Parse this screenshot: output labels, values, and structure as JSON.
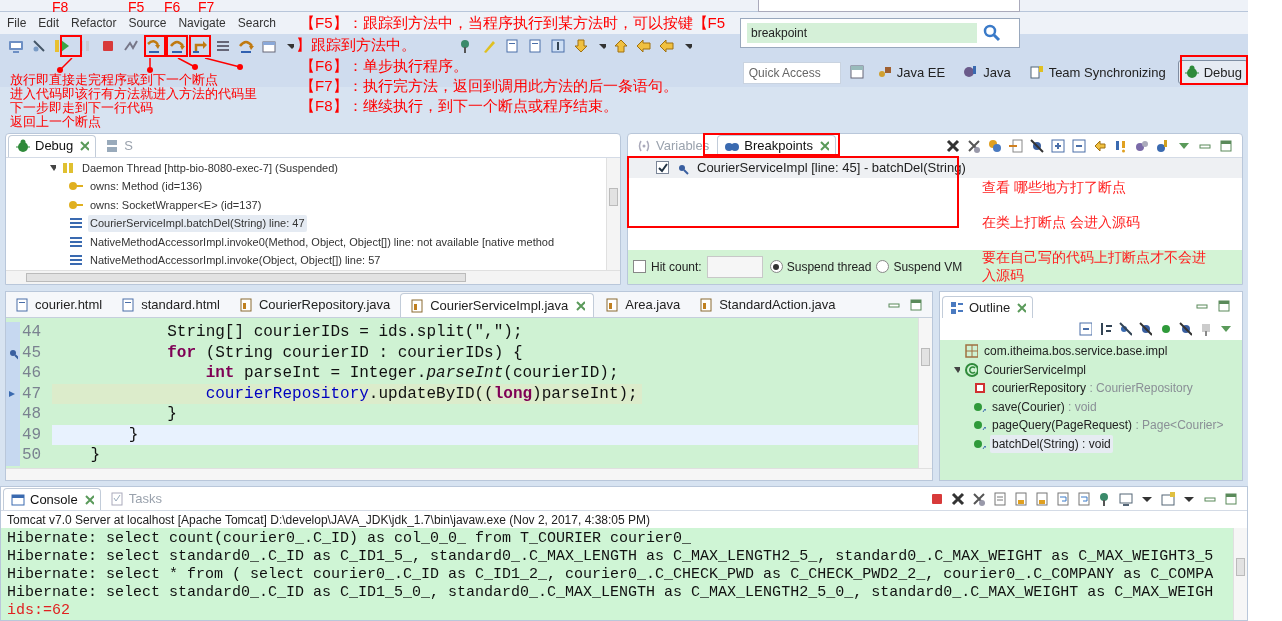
{
  "search_popup": {
    "value": "breakpoint"
  },
  "menu": [
    "File",
    "Edit",
    "Refactor",
    "Source",
    "Navigate",
    "Search"
  ],
  "quick_access": {
    "placeholder": "Quick Access"
  },
  "perspectives": [
    {
      "label": "Java EE",
      "selected": false
    },
    {
      "label": "Java",
      "selected": false
    },
    {
      "label": "Team Synchronizing",
      "selected": false
    },
    {
      "label": "Debug",
      "selected": true
    }
  ],
  "debug_view": {
    "tabs": [
      {
        "label": "Debug",
        "selected": true
      },
      {
        "label": "S",
        "selected": false
      }
    ],
    "tree": [
      {
        "text": "Daemon Thread [http-bio-8080-exec-7] (Suspended)",
        "kind": "thread",
        "expanded": true,
        "selected": false,
        "children": [
          {
            "text": "owns: Method  (id=136)",
            "kind": "monitor",
            "selected": false
          },
          {
            "text": "owns: SocketWrapper<E>  (id=137)",
            "kind": "monitor",
            "selected": false
          },
          {
            "text": "CourierServiceImpl.batchDel(String) line: 47",
            "kind": "frame",
            "selected": true
          },
          {
            "text": "NativeMethodAccessorImpl.invoke0(Method, Object, Object[]) line: not available [native method",
            "kind": "frame",
            "selected": false
          },
          {
            "text": "NativeMethodAccessorImpl.invoke(Object, Object[]) line: 57",
            "kind": "frame",
            "selected": false
          }
        ]
      }
    ]
  },
  "breakpoints_view": {
    "tabs": [
      {
        "label": "Variables",
        "selected": false
      },
      {
        "label": "Breakpoints",
        "selected": true
      }
    ],
    "breakpoints": [
      {
        "text": "CourierServiceImpl [line: 45] - batchDel(String)",
        "checked": true
      }
    ],
    "hit_count": {
      "label": "Hit count:",
      "checked": false
    },
    "suspend": [
      {
        "label": "Suspend thread",
        "selected": true
      },
      {
        "label": "Suspend VM",
        "selected": false
      }
    ]
  },
  "editor": {
    "tabs": [
      {
        "label": "courier.html",
        "kind": "html",
        "selected": false
      },
      {
        "label": "standard.html",
        "kind": "html",
        "selected": false
      },
      {
        "label": "CourierRepository.java",
        "kind": "java",
        "selected": false
      },
      {
        "label": "CourierServiceImpl.java",
        "kind": "java",
        "selected": true
      },
      {
        "label": "Area.java",
        "kind": "java",
        "selected": false
      },
      {
        "label": "StandardAction.java",
        "kind": "java",
        "selected": false
      }
    ],
    "lines": [
      {
        "number": "44",
        "breakpoint": false,
        "current": false,
        "cursor": false,
        "tokens": [
          {
            "text": "            String[] courierIDs = ids.split(\",\");",
            "kind": "plain"
          }
        ]
      },
      {
        "number": "45",
        "breakpoint": true,
        "current": false,
        "cursor": false,
        "tokens": [
          {
            "text": "            for",
            "kind": "keyword"
          },
          {
            "text": " (String courierID : courierIDs) {",
            "kind": "plain"
          }
        ]
      },
      {
        "number": "46",
        "breakpoint": false,
        "current": false,
        "cursor": false,
        "tokens": [
          {
            "text": "                int",
            "kind": "keyword"
          },
          {
            "text": " parseInt = Integer.",
            "kind": "plain"
          },
          {
            "text": "parseInt",
            "kind": "static"
          },
          {
            "text": "(courierID);",
            "kind": "plain"
          }
        ]
      },
      {
        "number": "47",
        "breakpoint": false,
        "current": true,
        "cursor": false,
        "tokens": [
          {
            "text": "                courierRepository",
            "kind": "field"
          },
          {
            "text": ".updateByID((",
            "kind": "plain"
          },
          {
            "text": "long",
            "kind": "keyword"
          },
          {
            "text": ")parseInt);",
            "kind": "plain"
          }
        ]
      },
      {
        "number": "48",
        "breakpoint": false,
        "current": false,
        "cursor": false,
        "tokens": [
          {
            "text": "            }",
            "kind": "plain"
          }
        ]
      },
      {
        "number": "49",
        "breakpoint": false,
        "current": false,
        "cursor": true,
        "tokens": [
          {
            "text": "        }",
            "kind": "plain"
          }
        ]
      },
      {
        "number": "50",
        "breakpoint": false,
        "current": false,
        "cursor": false,
        "tokens": [
          {
            "text": "    }",
            "kind": "plain"
          }
        ]
      }
    ]
  },
  "outline": {
    "title": "Outline",
    "tree": [
      {
        "name": "com.itheima.bos.service.base.impl",
        "kind": "package",
        "selected": false
      },
      {
        "name": "CourierServiceImpl",
        "kind": "class",
        "expanded": true,
        "selected": false,
        "children": [
          {
            "name": "courierRepository",
            "type": " : CourierRepository",
            "kind": "field",
            "selected": false
          },
          {
            "name": "save(Courier)",
            "type": " : void",
            "kind": "method",
            "selected": false
          },
          {
            "name": "pageQuery(PageRequest)",
            "type": " : Page<Courier>",
            "kind": "method",
            "selected": false
          },
          {
            "name": "batchDel(String)",
            "type": " : void",
            "kind": "method",
            "selected": true
          }
        ]
      }
    ]
  },
  "console": {
    "tabs": [
      {
        "label": "Console",
        "selected": true
      },
      {
        "label": "Tasks",
        "selected": false
      }
    ],
    "launch": "Tomcat v7.0 Server at localhost [Apache Tomcat] D:\\develop\\JAVA_JDK\\jdk_1.7\\bin\\javaw.exe (Nov 2, 2017, 4:38:05 PM)",
    "lines": [
      {
        "text": "Hibernate: select count(courier0_.C_ID) as col_0_0_ from T_COURIER courier0_",
        "kind": "out"
      },
      {
        "text": "Hibernate: select standard0_.C_ID as C_ID1_5_, standard0_.C_MAX_LENGTH as C_MAX_LENGTH2_5_, standard0_.C_MAX_WEIGHT as C_MAX_WEIGHT3_5",
        "kind": "out"
      },
      {
        "text": "Hibernate: select * from ( select courier0_.C_ID as C_ID1_2_, courier0_.C_CHECK_PWD as C_CHECK_PWD2_2_, courier0_.C_COMPANY as C_COMPA",
        "kind": "out"
      },
      {
        "text": "Hibernate: select standard0_.C_ID as C_ID1_5_0_, standard0_.C_MAX_LENGTH as C_MAX_LENGTH2_5_0_, standard0_.C_MAX_WEIGHT as C_MAX_WEIGH",
        "kind": "out"
      },
      {
        "text": "ids:=62",
        "kind": "err"
      }
    ]
  },
  "annotations": {
    "keys": [
      "F8",
      "F5",
      "F6",
      "F7"
    ],
    "columns": [
      "放行即直接走完程序或到下一个断点",
      "进入代码即该行有方法就进入方法的代码里",
      "下一步即走到下一行代码",
      "返回上一个断点"
    ],
    "help": [
      "【F5】：跟踪到方法中，当程序执行到某方法时，可以按键【F5",
      "】跟踪到方法中。",
      "【F6】：单步执行程序。",
      "【F7】：执行完方法，返回到调用此方法的后一条语句。",
      "【F8】：继续执行，到下一个断点或程序结束。"
    ],
    "notes": [
      "查看 哪些地方打了断点",
      "在类上打断点 会进入源码",
      "要在自己写的代码上打断点才不会进入源码"
    ]
  }
}
